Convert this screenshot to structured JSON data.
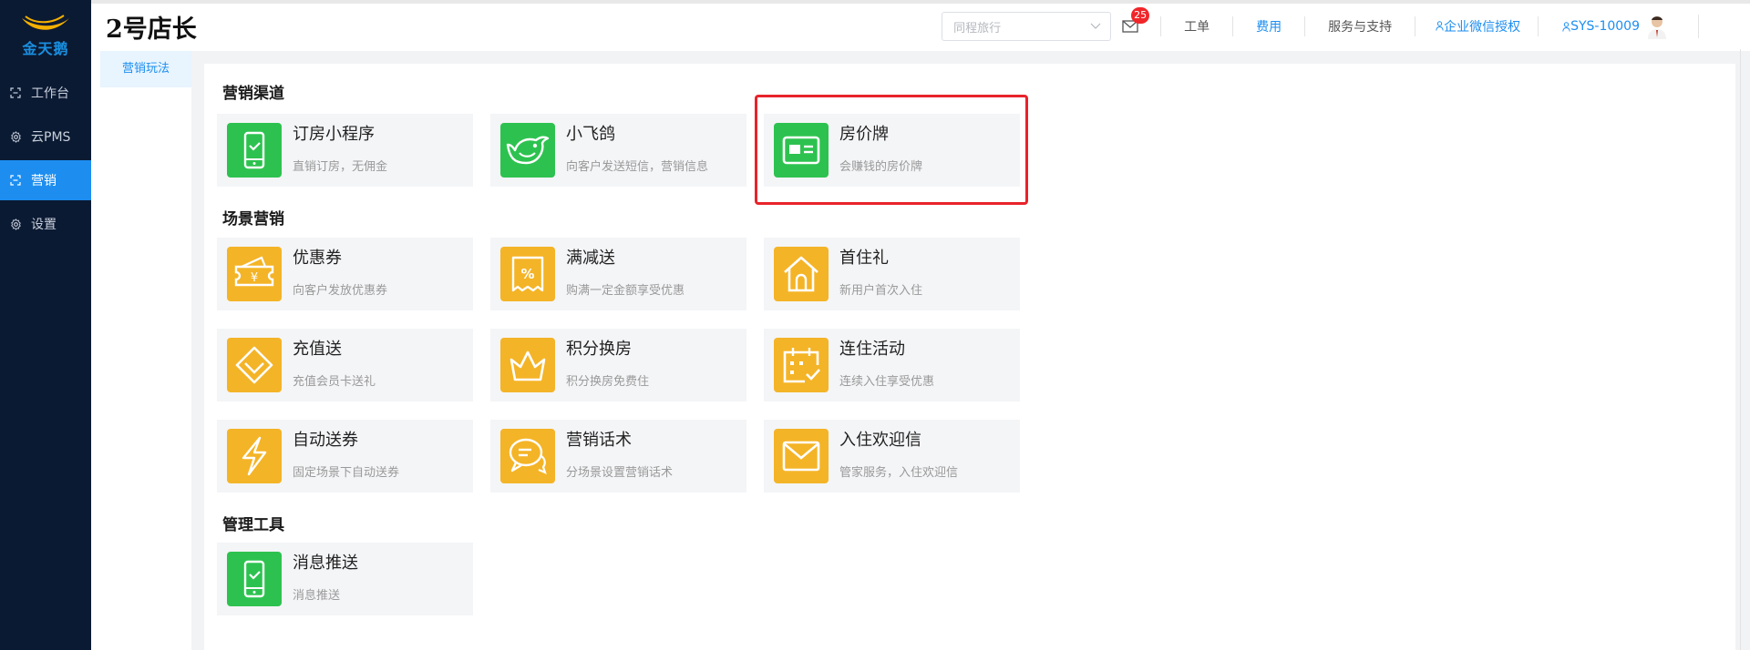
{
  "logo": {
    "text": "金天鹅"
  },
  "sidebar": {
    "items": [
      {
        "label": "工作台",
        "icon": "grid-icon",
        "active": false
      },
      {
        "label": "云PMS",
        "icon": "gear-icon",
        "active": false
      },
      {
        "label": "营销",
        "icon": "grid-icon",
        "active": true
      },
      {
        "label": "设置",
        "icon": "gear-icon",
        "active": false
      }
    ]
  },
  "header": {
    "title": "2号店长",
    "channel_select": {
      "placeholder": "同程旅行"
    },
    "mail_badge": "25",
    "links": {
      "ticket": "工单",
      "fees": "费用",
      "support": "服务与支持",
      "wechat_auth": "企业微信授权"
    },
    "user": {
      "name": "SYS-10009"
    }
  },
  "subnav": {
    "tab": "营销玩法"
  },
  "sections": {
    "channels": {
      "title": "营销渠道",
      "cards": [
        {
          "name": "订房小程序",
          "desc": "直销订房，无佣金",
          "icon": "phone-check-icon",
          "color": "#2dc24f"
        },
        {
          "name": "小飞鸽",
          "desc": "向客户发送短信，营销信息",
          "icon": "bird-icon",
          "color": "#2dc24f"
        },
        {
          "name": "房价牌",
          "desc": "会赚钱的房价牌",
          "icon": "id-card-icon",
          "color": "#2dc24f"
        }
      ]
    },
    "scenario": {
      "title": "场景营销",
      "cards": [
        {
          "name": "优惠券",
          "desc": "向客户发放优惠券",
          "icon": "coupon-icon",
          "color": "#f4b427"
        },
        {
          "name": "满减送",
          "desc": "购满一定金额享受优惠",
          "icon": "percent-icon",
          "color": "#f4b427"
        },
        {
          "name": "首住礼",
          "desc": "新用户首次入住",
          "icon": "house-icon",
          "color": "#f4b427"
        },
        {
          "name": "充值送",
          "desc": "充值会员卡送礼",
          "icon": "diamond-icon",
          "color": "#f4b427"
        },
        {
          "name": "积分换房",
          "desc": "积分换房免费住",
          "icon": "crown-icon",
          "color": "#f4b427"
        },
        {
          "name": "连住活动",
          "desc": "连续入住享受优惠",
          "icon": "calendar-icon",
          "color": "#f4b427"
        },
        {
          "name": "自动送券",
          "desc": "固定场景下自动送券",
          "icon": "lightning-icon",
          "color": "#f4b427"
        },
        {
          "name": "营销话术",
          "desc": "分场景设置营销话术",
          "icon": "chat-icon",
          "color": "#f4b427"
        },
        {
          "name": "入住欢迎信",
          "desc": "管家服务，入住欢迎信",
          "icon": "envelope-icon",
          "color": "#f4b427"
        }
      ]
    },
    "tools": {
      "title": "管理工具",
      "cards": [
        {
          "name": "消息推送",
          "desc": "消息推送",
          "icon": "phone-check-icon",
          "color": "#2dc24f"
        }
      ]
    }
  }
}
